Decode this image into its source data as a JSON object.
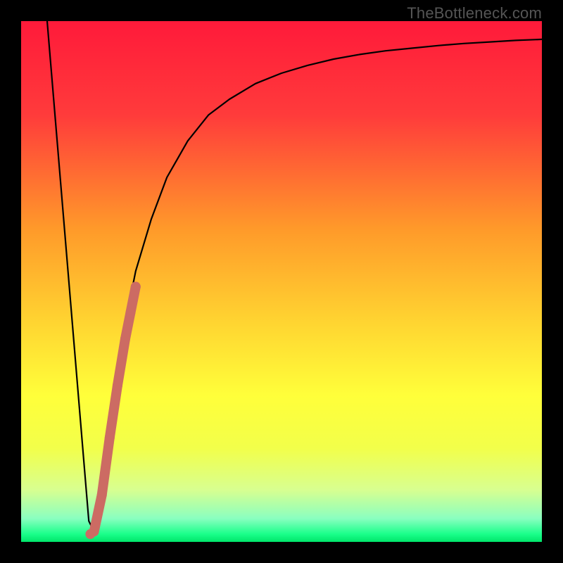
{
  "watermark": "TheBottleneck.com",
  "chart_data": {
    "type": "line",
    "title": "",
    "xlabel": "",
    "ylabel": "",
    "xlim": [
      0,
      100
    ],
    "ylim": [
      0,
      100
    ],
    "grid": false,
    "legend": false,
    "series": [
      {
        "name": "bottleneck-curve",
        "color": "#000000",
        "x": [
          5,
          6,
          7,
          8,
          9,
          10,
          11,
          12,
          13,
          14,
          15,
          16,
          18,
          20,
          22,
          25,
          28,
          32,
          36,
          40,
          45,
          50,
          55,
          60,
          65,
          70,
          75,
          80,
          85,
          90,
          95,
          100
        ],
        "y": [
          100,
          88,
          76,
          64,
          52,
          40,
          28,
          16,
          4,
          2,
          8,
          16,
          30,
          42,
          52,
          62,
          70,
          77,
          82,
          85,
          88,
          90,
          91.5,
          92.7,
          93.6,
          94.3,
          94.8,
          95.3,
          95.7,
          96,
          96.3,
          96.5
        ]
      },
      {
        "name": "highlight-segment",
        "color": "#cc6b63",
        "style": "thick-dotted",
        "x": [
          14.0,
          15.5,
          17.0,
          18.5,
          20.0,
          21.0,
          22.0
        ],
        "y": [
          2,
          9,
          20,
          30,
          39,
          44,
          49
        ]
      },
      {
        "name": "highlight-anchor",
        "color": "#cc6b63",
        "style": "dot",
        "x": [
          13.3
        ],
        "y": [
          1.5
        ]
      }
    ],
    "background_gradient_stops": [
      {
        "pos": 0.0,
        "color": "#ff1a3a"
      },
      {
        "pos": 0.18,
        "color": "#ff3b3b"
      },
      {
        "pos": 0.4,
        "color": "#ff9a2a"
      },
      {
        "pos": 0.58,
        "color": "#ffd531"
      },
      {
        "pos": 0.72,
        "color": "#ffff3a"
      },
      {
        "pos": 0.82,
        "color": "#f2ff4a"
      },
      {
        "pos": 0.9,
        "color": "#d8ff90"
      },
      {
        "pos": 0.955,
        "color": "#8affc0"
      },
      {
        "pos": 0.985,
        "color": "#1aff8a"
      },
      {
        "pos": 1.0,
        "color": "#00e56a"
      }
    ]
  }
}
